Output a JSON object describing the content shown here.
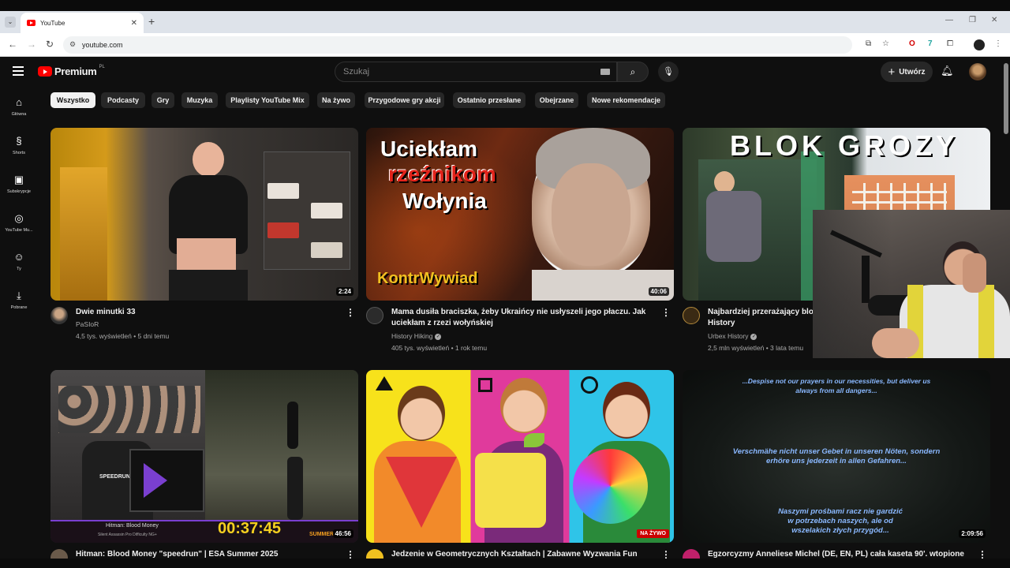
{
  "browser": {
    "tab_title": "YouTube",
    "url": "youtube.com"
  },
  "header": {
    "logo_text": "Premium",
    "logo_region": "PL",
    "search_placeholder": "Szukaj",
    "create_label": "Utwórz"
  },
  "sidebar": {
    "items": [
      {
        "label": "Główna",
        "icon": "home-icon"
      },
      {
        "label": "Shorts",
        "icon": "shorts-icon"
      },
      {
        "label": "Subskrypcje",
        "icon": "subscriptions-icon"
      },
      {
        "label": "YouTube Mu...",
        "icon": "youtube-music-icon"
      },
      {
        "label": "Ty",
        "icon": "you-icon"
      },
      {
        "label": "Pobrane",
        "icon": "downloads-icon"
      }
    ]
  },
  "chips": [
    "Wszystko",
    "Podcasty",
    "Gry",
    "Muzyka",
    "Playlisty YouTube Mix",
    "Na żywo",
    "Przygodowe gry akcji",
    "Ostatnio przesłane",
    "Obejrzane",
    "Nowe rekomendacje"
  ],
  "videos": [
    {
      "title_line1": "Dwie minutki 33",
      "title_line2": "",
      "channel": "PaSIoR",
      "meta": "4,5 tys. wyświetleń • 5 dni temu",
      "duration": "2:24",
      "verified": false
    },
    {
      "title_line1": "Mama dusiła braciszka, żeby Ukraińcy nie usłyszeli jego płaczu. Jak",
      "title_line2": "uciekłam z rzezi wołyńskiej",
      "channel": "History Hiking",
      "meta": "405 tys. wyświetleń • 1 rok temu",
      "duration": "40:06",
      "verified": true
    },
    {
      "title_line1": "Najbardziej przerażający blo",
      "title_line2": "History",
      "channel": "Urbex History",
      "meta": "2,5 mln wyświetleń • 3 lata temu",
      "duration": "",
      "verified": true
    },
    {
      "title_line1": "Hitman: Blood Money \"speedrun\" | ESA Summer 2025",
      "channel": "",
      "meta": "",
      "duration": "46:56"
    },
    {
      "title_line1": "Jedzenie w Geometrycznych Kształtach | Zabawne Wyzwania Fun",
      "channel": "",
      "meta": "",
      "duration": "",
      "live": "NA ŻYWO"
    },
    {
      "title_line1": "Egzorcyzmy Anneliese Michel (DE, EN, PL) cała kaseta 90'. wtopione",
      "channel": "",
      "meta": "",
      "duration": "2:09:56"
    }
  ],
  "thumb_texts": {
    "v2_line1": "Uciekłam",
    "v2_line2": "rzeźnikom",
    "v2_line3": "Wołynia",
    "v2_brand": "KontrWywiad",
    "v3_title": "BLOK GROZY",
    "v4_game": "Hitman: Blood Money",
    "v4_timer": "00:37:45",
    "v4_sub": "Silent Assassin Pro Difficulty NG+",
    "v4_shirt": "SPEEDRUN",
    "v4_event": "SUMMER",
    "v6_en": "...Despise not our prayers in our necessities, but deliver us always from all dangers...",
    "v6_de": "Verschmähe nicht unser Gebet in unseren Nöten, sondern erhöre uns jederzeit in allen Gefahren...",
    "v6_pl": "Naszymi prośbami racz nie gardzić w potrzebach naszych, ale od wszelakich złych przygód..."
  },
  "colors": {
    "background": "#0f0f0f",
    "accent_red": "#ff0000",
    "chip_bg": "#272727",
    "chip_active_bg": "#f1f1f1"
  }
}
